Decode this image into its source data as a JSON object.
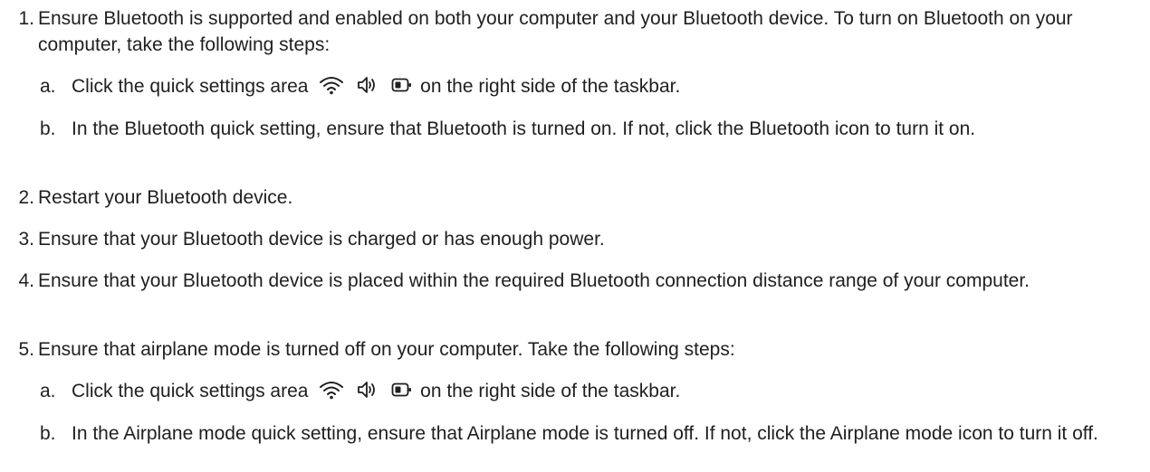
{
  "steps": [
    {
      "num": "1.",
      "text": "Ensure Bluetooth is supported and enabled on both your computer and your Bluetooth device. To turn on Bluetooth on your computer, take the following steps:",
      "substeps": [
        {
          "letter": "a.",
          "before": "Click the quick settings area",
          "after": "on the right side of the taskbar.",
          "icons": [
            "wifi-icon",
            "volume-icon",
            "battery-icon"
          ]
        },
        {
          "letter": "b.",
          "text": "In the Bluetooth quick setting, ensure that Bluetooth is turned on. If not, click the Bluetooth icon to turn it on."
        }
      ]
    },
    {
      "num": "2.",
      "text": "Restart your Bluetooth device."
    },
    {
      "num": "3.",
      "text": "Ensure that your Bluetooth device is charged or has enough power."
    },
    {
      "num": "4.",
      "text": "Ensure that your Bluetooth device is placed within the required Bluetooth connection distance range of your computer."
    },
    {
      "num": "5.",
      "text": "Ensure that airplane mode is turned off on your computer. Take the following steps:",
      "substeps": [
        {
          "letter": "a.",
          "before": "Click the quick settings area",
          "after": "on the right side of the taskbar.",
          "icons": [
            "wifi-icon",
            "volume-icon",
            "battery-icon"
          ]
        },
        {
          "letter": "b.",
          "text": "In the Airplane mode quick setting, ensure that Airplane mode is turned off. If not, click the Airplane mode icon to turn it off."
        }
      ]
    }
  ]
}
